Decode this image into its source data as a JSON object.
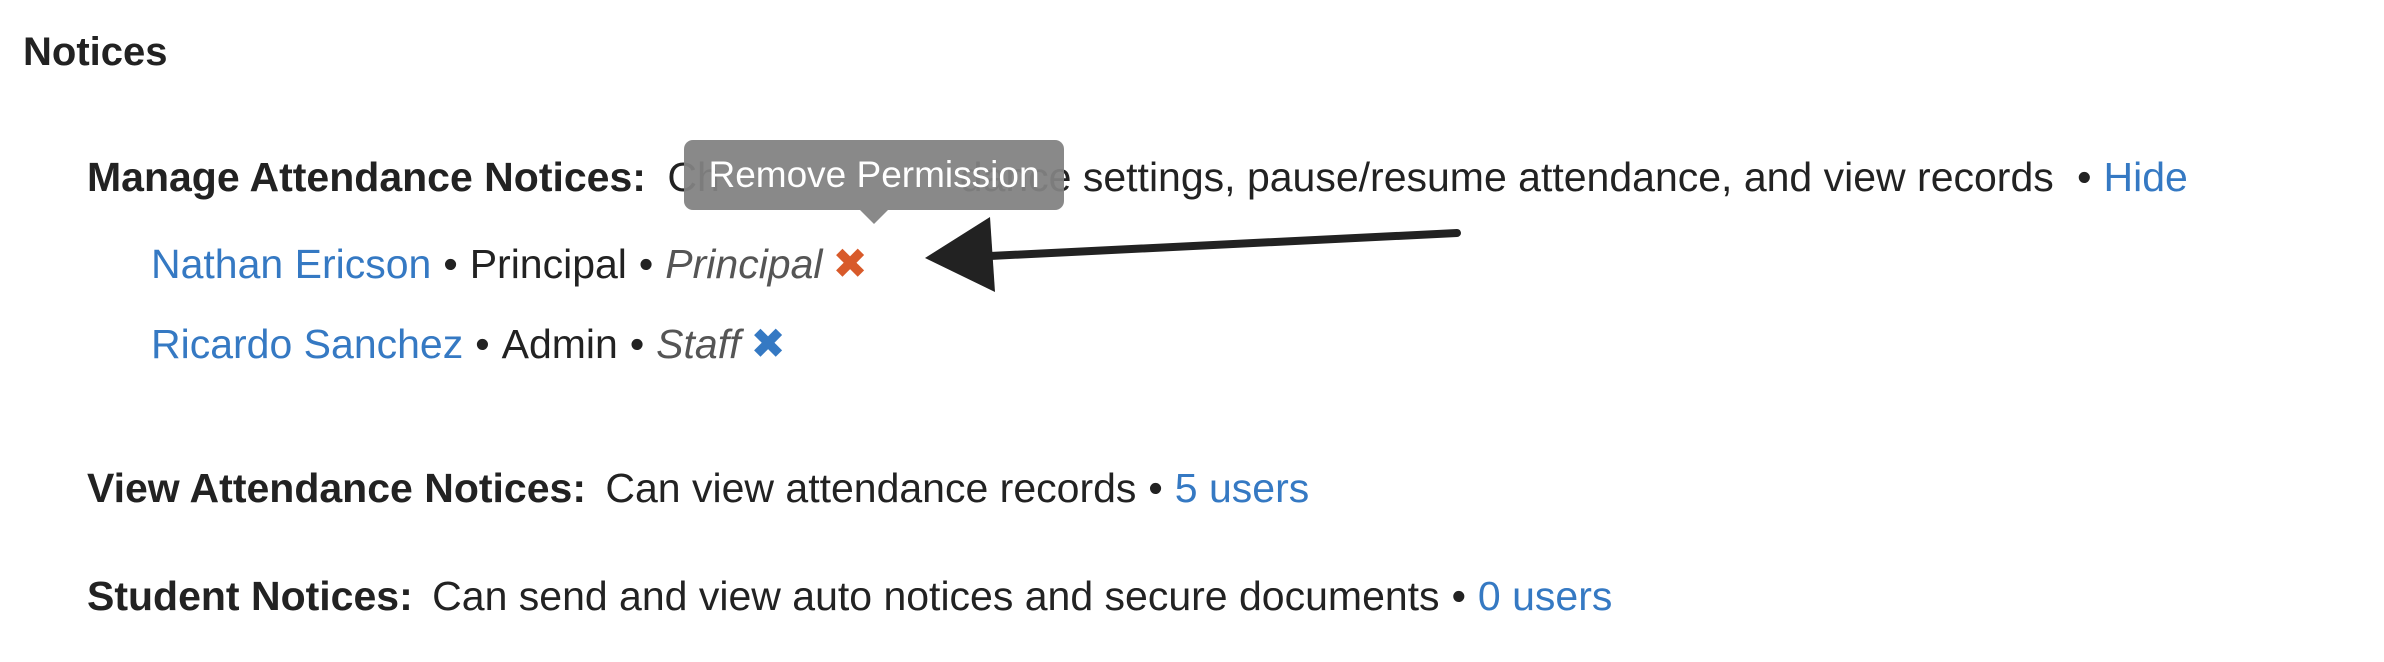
{
  "section": {
    "title": "Notices"
  },
  "manage": {
    "label": "Manage Attendance Notices:",
    "description_hidden_start": "Ch",
    "description_visible": "dance settings, pause/resume attendance, and view records",
    "hide_link": "Hide",
    "users": [
      {
        "name": "Nathan Ericson",
        "title": "Principal",
        "role": "Principal"
      },
      {
        "name": "Ricardo Sanchez",
        "title": "Admin",
        "role": "Staff"
      }
    ]
  },
  "tooltip": {
    "text": "Remove Permission"
  },
  "view": {
    "label": "View Attendance Notices:",
    "description": "Can view attendance records",
    "users_link": "5 users"
  },
  "student": {
    "label": "Student Notices:",
    "description": "Can send and view auto notices and secure documents",
    "users_link": "0 users"
  },
  "icons": {
    "remove": "close-x-icon",
    "annotation": "arrow-icon"
  },
  "colors": {
    "link": "#3579c3",
    "remove_hover": "#d85a2a",
    "tooltip_bg": "#828282"
  }
}
